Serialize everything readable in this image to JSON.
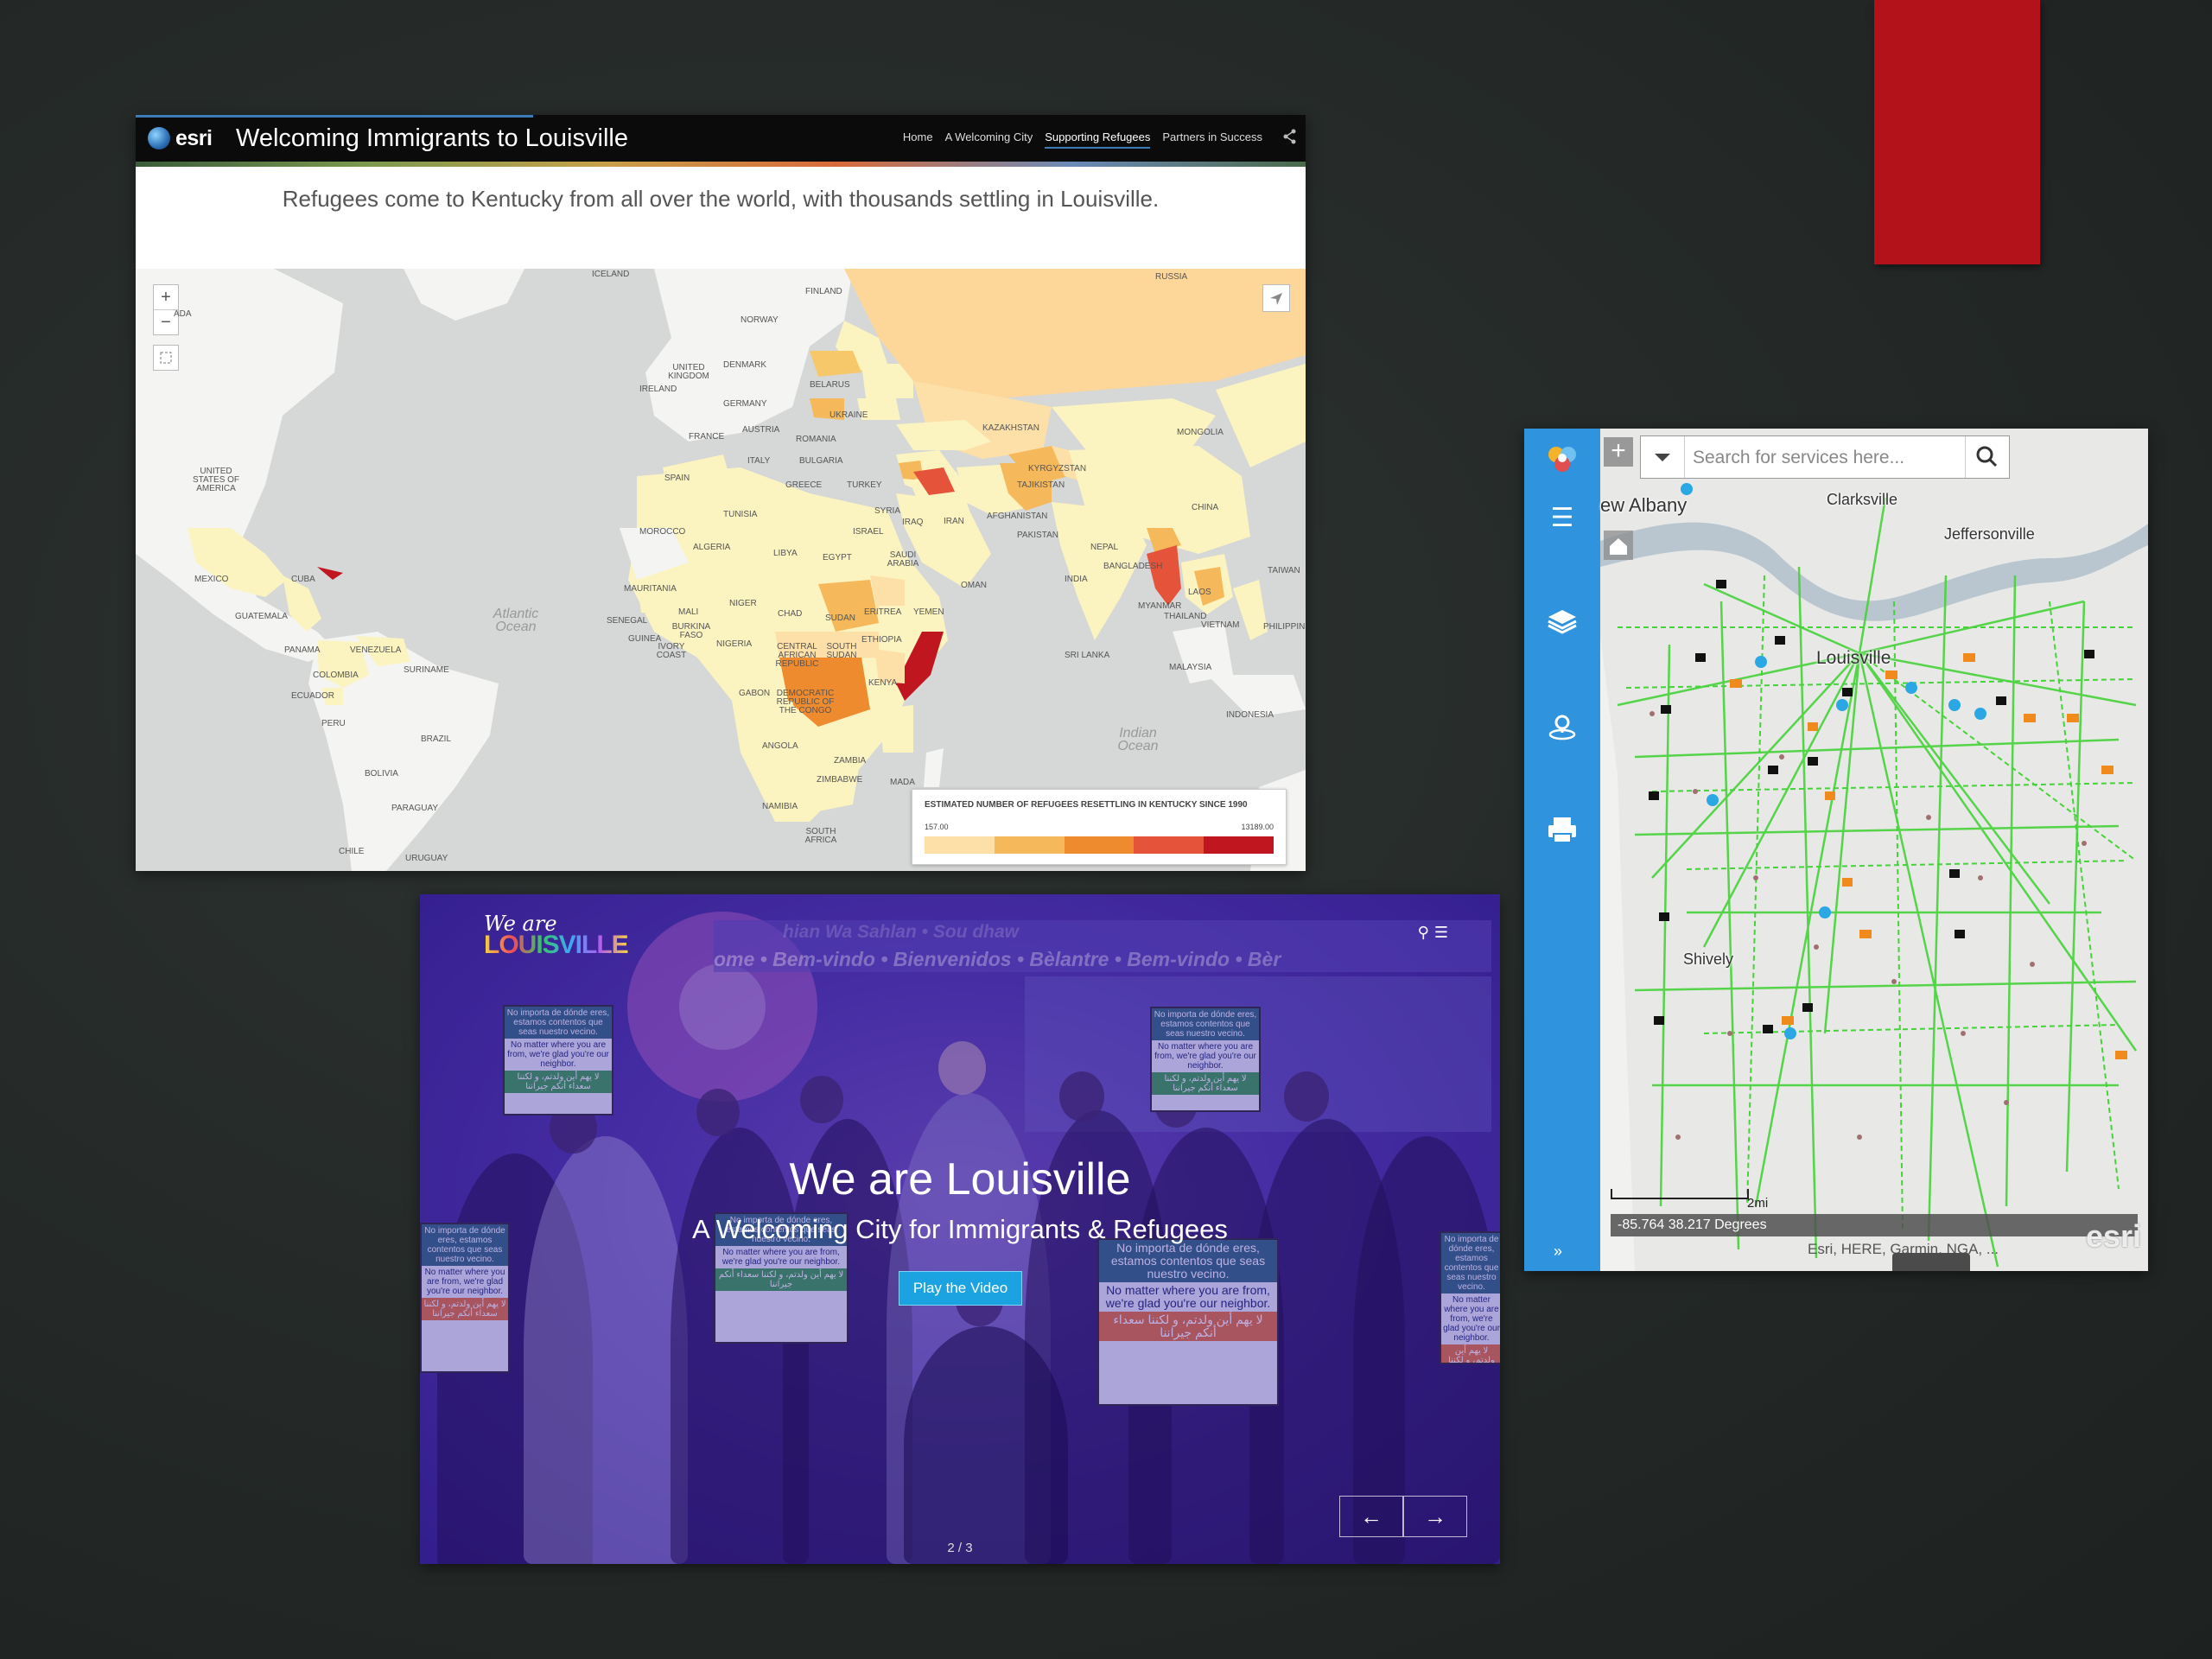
{
  "story_map": {
    "brand": "esri",
    "title": "Welcoming Immigrants to Louisville",
    "nav": [
      "Home",
      "A Welcoming City",
      "Supporting Refugees",
      "Partners in Success"
    ],
    "nav_active_index": 2,
    "subtitle": "Refugees come to Kentucky from all over the world, with thousands settling in Louisville.",
    "map_labels": {
      "countries": [
        "ICELAND",
        "FINLAND",
        "RUSSIA",
        "NORWAY",
        "UNITED KINGDOM",
        "IRELAND",
        "DENMARK",
        "BELARUS",
        "GERMANY",
        "UKRAINE",
        "FRANCE",
        "AUSTRIA",
        "ROMANIA",
        "KAZAKHSTAN",
        "MONGOLIA",
        "ITALY",
        "BULGARIA",
        "KYRGYZSTAN",
        "SPAIN",
        "GREECE",
        "TURKEY",
        "TAJIKISTAN",
        "SYRIA",
        "IRAQ",
        "IRAN",
        "AFGHANISTAN",
        "CHINA",
        "UNITED STATES OF AMERICA",
        "TUNISIA",
        "MOROCCO",
        "ISRAEL",
        "PAKISTAN",
        "NEPAL",
        "ALGERIA",
        "LIBYA",
        "EGYPT",
        "SAUDI ARABIA",
        "BANGLADESH",
        "TAIWAN",
        "MEXICO",
        "CUBA",
        "INDIA",
        "OMAN",
        "MAURITANIA",
        "MYANMAR",
        "THAILAND",
        "LAOS",
        "PHILIPPINES",
        "MALI",
        "NIGER",
        "CHAD",
        "SUDAN",
        "ERITREA",
        "YEMEN",
        "VIETNAM",
        "GUATEMALA",
        "SENEGAL",
        "BURKINA FASO",
        "GUINEA",
        "IVORY COAST",
        "NIGERIA",
        "CENTRAL AFRICAN REPUBLIC",
        "SOUTH SUDAN",
        "ETHIOPIA",
        "SRI LANKA",
        "PANAMA",
        "VENEZUELA",
        "MALAYSIA",
        "COLOMBIA",
        "SURINAME",
        "GABON",
        "DEMOCRATIC REPUBLIC OF THE CONGO",
        "KENYA",
        "ECUADOR",
        "INDONESIA",
        "PERU",
        "BRAZIL",
        "ANGOLA",
        "ZAMBIA",
        "BOLIVIA",
        "ZIMBABWE",
        "MADA",
        "NAMIBIA",
        "PARAGUAY",
        "SOUTH AFRICA",
        "CHILE",
        "URUGUAY",
        "ADA"
      ],
      "oceans": [
        "Atlantic Ocean",
        "Indian Ocean"
      ]
    },
    "legend": {
      "title": "ESTIMATED NUMBER OF REFUGEES RESETTLING IN KENTUCKY SINCE 1990",
      "min": "157.00",
      "max": "13189.00",
      "colors": [
        "#fde0a8",
        "#f5b85a",
        "#ef8b2f",
        "#e5543a",
        "#c0161f"
      ]
    },
    "controls": {
      "zoom_in": "+",
      "zoom_out": "−"
    }
  },
  "louisville_site": {
    "logo_line1": "We are",
    "logo_line2": "LOUISVILLE",
    "headline": "We are Louisville",
    "subheadline": "A Welcoming City for Immigrants & Refugees",
    "play_button": "Play the Video",
    "slide_counter": "2 / 3",
    "prev_arrow": "←",
    "next_arrow": "→",
    "banner_text": "ome • Bem-vindo • Bienvenidos • Bèlantre • Bem-vindo • Bèr",
    "banner_text_top": "hian Wa Sahlan • Sou dhaw",
    "sign_lines": [
      "No importa de dónde eres, estamos contentos que seas nuestro vecino.",
      "No matter where you are from, we're glad you're our neighbor.",
      "لا يهم أين ولدتم، و لكننا سعداء أنكم جيراننا"
    ]
  },
  "services_map": {
    "search_placeholder": "Search for services here...",
    "places": [
      "ew Albany",
      "Clarksville",
      "Jeffersonville",
      "Louisville",
      "Shively"
    ],
    "scale_label": "2mi",
    "coordinates": "-85.764 38.217 Degrees",
    "attribution": "Esri, HERE, Garmin, NGA, ...",
    "esri_logo": "esri",
    "sidebar_icons": [
      "app-logo-icon",
      "list-icon",
      "layers-icon",
      "location-icon",
      "print-icon"
    ],
    "expand_label": "»",
    "colors": {
      "sidebar": "#2f93dd",
      "routes": "#46d23a"
    }
  }
}
